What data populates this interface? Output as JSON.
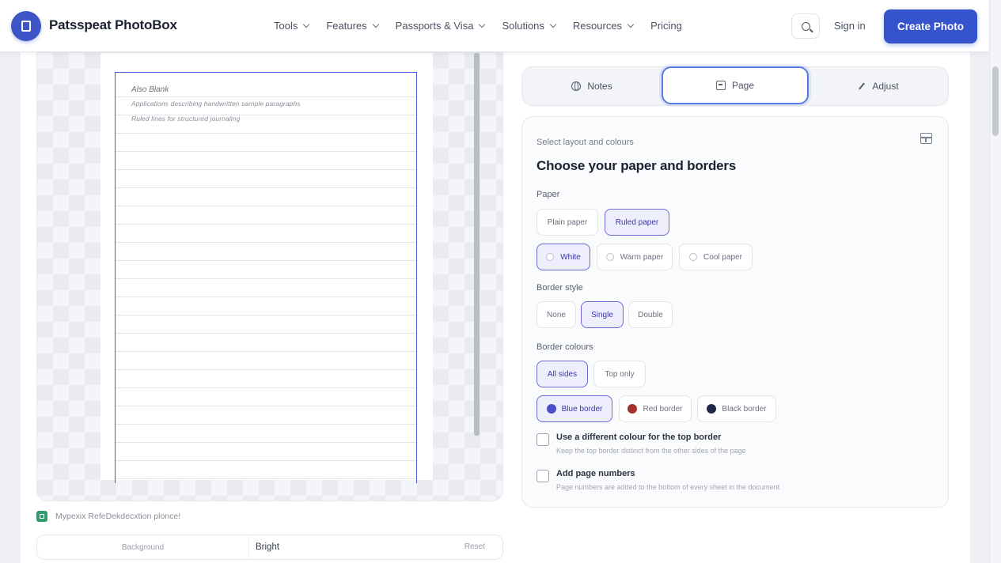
{
  "header": {
    "brand": "Patsspeat PhotoBox",
    "nav": [
      {
        "label": "Tools",
        "has_menu": true
      },
      {
        "label": "Features",
        "has_menu": true
      },
      {
        "label": "Passports & Visa",
        "has_menu": true
      },
      {
        "label": "Solutions",
        "has_menu": true
      },
      {
        "label": "Resources",
        "has_menu": true
      },
      {
        "label": "Pricing",
        "has_menu": false
      }
    ],
    "sign_in": "Sign in",
    "cta": "Create Photo"
  },
  "preview": {
    "paper_title": "Also Blank",
    "paper_lines": [
      "Applications describing handwritten sample paragraphs",
      "Ruled lines for structured journaling"
    ],
    "note": "Mypexix RefeDekdecxtion plonce!",
    "bottom": {
      "left": "Background",
      "middle": "Bright",
      "right": "Reset"
    }
  },
  "tabs": [
    {
      "label": "Notes",
      "icon": "globe-icon"
    },
    {
      "label": "Page",
      "icon": "page-icon"
    },
    {
      "label": "Adjust",
      "icon": "pen-icon"
    }
  ],
  "settings": {
    "kicker": "Select layout and colours",
    "title": "Choose your paper and borders",
    "paper_label": "Paper",
    "paper_options": [
      {
        "label": "Plain paper",
        "selected": false
      },
      {
        "label": "Ruled paper",
        "selected": true
      }
    ],
    "paper_tones": [
      {
        "label": "White",
        "selected": true
      },
      {
        "label": "Warm paper",
        "selected": false
      },
      {
        "label": "Cool paper",
        "selected": false
      }
    ],
    "border_style_label": "Border style",
    "border_styles": [
      {
        "label": "None",
        "selected": false
      },
      {
        "label": "Single",
        "selected": true
      },
      {
        "label": "Double",
        "selected": false
      }
    ],
    "border_colour_label": "Border colours",
    "border_scope": [
      {
        "label": "All sides",
        "selected": true
      },
      {
        "label": "Top only",
        "selected": false
      }
    ],
    "border_colours": [
      {
        "label": "Blue border",
        "color": "#4b4fc7",
        "selected": true
      },
      {
        "label": "Red border",
        "color": "#a3322b",
        "selected": false
      },
      {
        "label": "Black border",
        "color": "#1f2a4a",
        "selected": false
      }
    ],
    "checkboxes": [
      {
        "label": "Use a different colour for the top border",
        "help": "Keep the top border distinct from the other sides of the page",
        "checked": false
      },
      {
        "label": "Add page numbers",
        "help": "Page numbers are added to the bottom of every sheet in the document",
        "checked": false
      }
    ]
  },
  "colors": {
    "accent": "#3553cc",
    "selected_chip": "#efeefd",
    "frame_border": "#4b5ad1"
  }
}
